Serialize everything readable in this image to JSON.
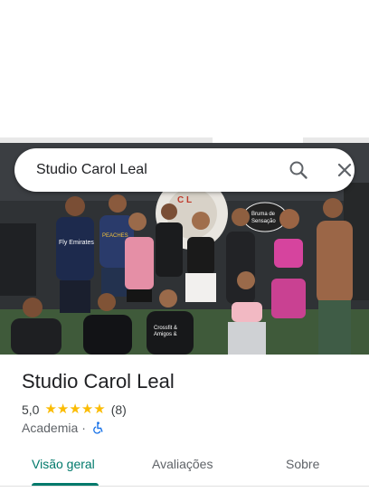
{
  "search": {
    "query": "Studio Carol Leal",
    "search_icon": "search-icon",
    "close_icon": "close-icon"
  },
  "photo": {
    "jersey_text_1": "Fly Emirates",
    "jersey_text_2": "PEACHES THE GYM",
    "shirt_text_1": "Crossfit & Amigos & Besouros",
    "shirt_text_2": "Crossfit & Amigos & Besouros",
    "wall_sign": "Bruma de Sensação"
  },
  "place": {
    "title": "Studio Carol Leal",
    "rating": "5,0",
    "stars": 5,
    "review_count": "(8)",
    "category": "Academia",
    "separator": "·",
    "accessibility_icon": "wheelchair-icon"
  },
  "tabs": [
    {
      "label": "Visão geral",
      "active": true
    },
    {
      "label": "Avaliações",
      "active": false
    },
    {
      "label": "Sobre",
      "active": false
    }
  ],
  "colors": {
    "accent": "#00796b",
    "star": "#fbbc04",
    "wheelchair": "#1a73e8"
  }
}
